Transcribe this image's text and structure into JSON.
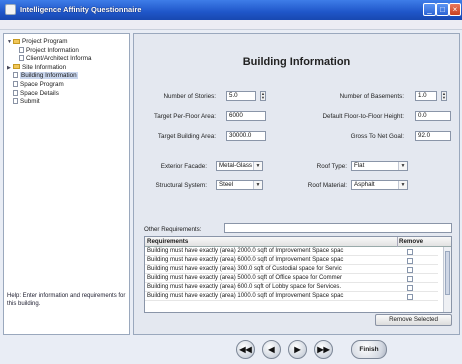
{
  "window": {
    "title": "Intelligence Affinity Questionnaire"
  },
  "tree": {
    "items": [
      {
        "label": "Project Program",
        "type": "folder",
        "level": 0
      },
      {
        "label": "Project Information",
        "type": "doc",
        "level": 1
      },
      {
        "label": "Client/Architect Informa",
        "type": "doc",
        "level": 1
      },
      {
        "label": "Site Information",
        "type": "folder",
        "level": 0
      },
      {
        "label": "Building Information",
        "type": "doc",
        "level": 1,
        "selected": true
      },
      {
        "label": "Space Program",
        "type": "doc",
        "level": 1
      },
      {
        "label": "Space Details",
        "type": "doc",
        "level": 1
      },
      {
        "label": "Submit",
        "type": "doc",
        "level": 1
      }
    ]
  },
  "help": {
    "text": "Help: Enter information and requirements for this building."
  },
  "form": {
    "heading": "Building Information",
    "stories_label": "Number of Stories:",
    "stories_value": "5.0",
    "basements_label": "Number of Basements:",
    "basements_value": "1.0",
    "floor_area_label": "Target Per-Floor Area:",
    "floor_area_value": "6000",
    "floor_height_label": "Default Floor-to-Floor Height:",
    "floor_height_value": "0.0",
    "building_area_label": "Target Building Area:",
    "building_area_value": "30000.0",
    "gross_net_label": "Gross To Net Goal:",
    "gross_net_value": "92.0",
    "facade_label": "Exterior Facade:",
    "facade_value": "Metal-Glass",
    "roof_type_label": "Roof Type:",
    "roof_type_value": "Flat",
    "structural_label": "Structural System:",
    "structural_value": "Steel",
    "roof_material_label": "Roof Material:",
    "roof_material_value": "Asphalt",
    "other_label": "Other Requirements:"
  },
  "requirements": {
    "col_requirements": "Requirements",
    "col_remove": "Remove",
    "rows": [
      "Building must have exactly (area) 2000.0 sqft of Improvement Space spac",
      "Building must have exactly (area) 6000.0 sqft of Improvement Space spac",
      "Building must have exactly (area) 300.0 sqft of Custodial space for Servic",
      "Building must have exactly (area) 5000.0 sqft of Office space for Commer",
      "Building must have exactly (area) 600.0 sqft of Lobby space for Services.",
      "Building must have exactly (area) 1000.0 sqft of Improvement Space spac"
    ],
    "remove_selected": "Remove Selected"
  },
  "nav": {
    "first": "◀◀",
    "prev": "◀",
    "next": "▶",
    "last": "▶▶",
    "finish": "Finish"
  }
}
